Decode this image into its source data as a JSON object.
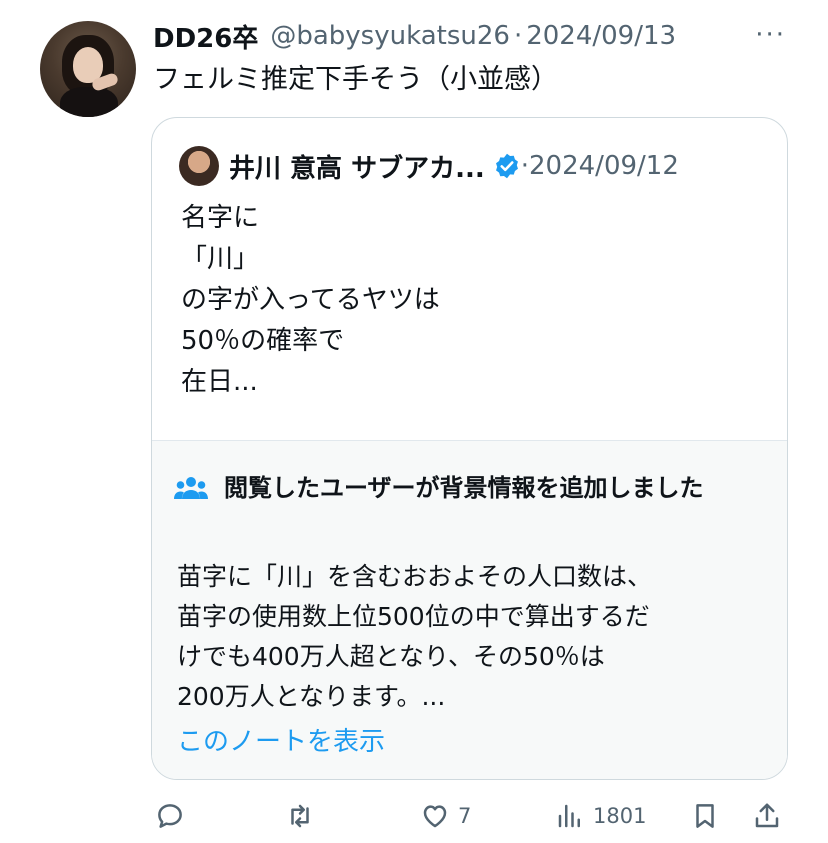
{
  "tweet": {
    "display_name": "DD26卒",
    "handle": "@babysyukatsu26",
    "separator": "·",
    "date": "2024/09/13",
    "more_icon": "more-horizontal-icon",
    "text": "フェルミ推定下手そう（小並感）"
  },
  "quoted": {
    "display_name": "井川 意高 サブアカ...",
    "verified_icon": "verified-badge-icon",
    "separator": "·",
    "date": "2024/09/12",
    "text": "名字に\n「川」\nの字が入ってるヤツは\n50％の確率で\n在日..."
  },
  "community_note": {
    "icon": "people-group-icon",
    "title": "閲覧したユーザーが背景情報を追加しました",
    "body": "苗字に「川」を含むおおよその人口数は、\n苗字の使用数上位500位の中で算出するだ\nけでも400万人超となり、その50％は\n200万人となります。...",
    "link": "このノートを表示"
  },
  "actions": {
    "reply_icon": "reply-icon",
    "retweet_icon": "retweet-icon",
    "like_icon": "heart-icon",
    "like_count": "7",
    "views_icon": "views-chart-icon",
    "view_count": "1801",
    "bookmark_icon": "bookmark-icon",
    "share_icon": "share-icon"
  },
  "colors": {
    "text": "#0f1419",
    "secondary": "#536471",
    "link": "#1d9bf0",
    "border": "#cfd9de",
    "note_bg": "#f7f9f9"
  }
}
